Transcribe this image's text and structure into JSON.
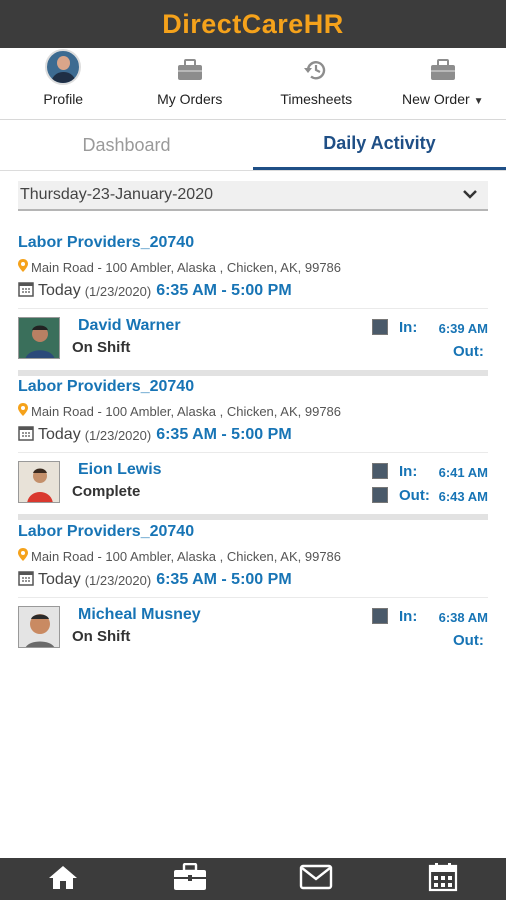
{
  "app": {
    "title": "DirectCareHR"
  },
  "topnav": {
    "profile_label": "Profile",
    "orders_label": "My Orders",
    "timesheets_label": "Timesheets",
    "new_order_label": "New Order"
  },
  "tabs": {
    "dashboard": "Dashboard",
    "daily_activity": "Daily Activity"
  },
  "date_select": {
    "value": "Thursday-23-January-2020"
  },
  "activities": [
    {
      "provider": "Labor Providers_20740",
      "address": "Main Road - 100 Ambler, Alaska , Chicken, AK, 99786",
      "today": "Today",
      "date": "(1/23/2020)",
      "hours": "6:35 AM - 5:00 PM",
      "worker": "David Warner",
      "status": "On Shift",
      "in_label": "In:",
      "in_time": "6:39 AM",
      "out_label": "Out:",
      "out_time": ""
    },
    {
      "provider": "Labor Providers_20740",
      "address": "Main Road - 100 Ambler, Alaska , Chicken, AK, 99786",
      "today": "Today",
      "date": "(1/23/2020)",
      "hours": "6:35 AM - 5:00 PM",
      "worker": "Eion Lewis",
      "status": "Complete",
      "in_label": "In:",
      "in_time": "6:41 AM",
      "out_label": "Out:",
      "out_time": "6:43 AM"
    },
    {
      "provider": "Labor Providers_20740",
      "address": "Main Road - 100 Ambler, Alaska , Chicken, AK, 99786",
      "today": "Today",
      "date": "(1/23/2020)",
      "hours": "6:35 AM - 5:00 PM",
      "worker": "Micheal Musney",
      "status": "On Shift",
      "in_label": "In:",
      "in_time": "6:38 AM",
      "out_label": "Out:",
      "out_time": ""
    }
  ],
  "bottom_nav": [
    "home-icon",
    "briefcase-icon",
    "mail-icon",
    "calendar-icon"
  ],
  "colors": {
    "header_bg": "#3c3c3c",
    "brand": "#f5a21b",
    "link": "#1774b5",
    "tab_active": "#1f4f86"
  }
}
